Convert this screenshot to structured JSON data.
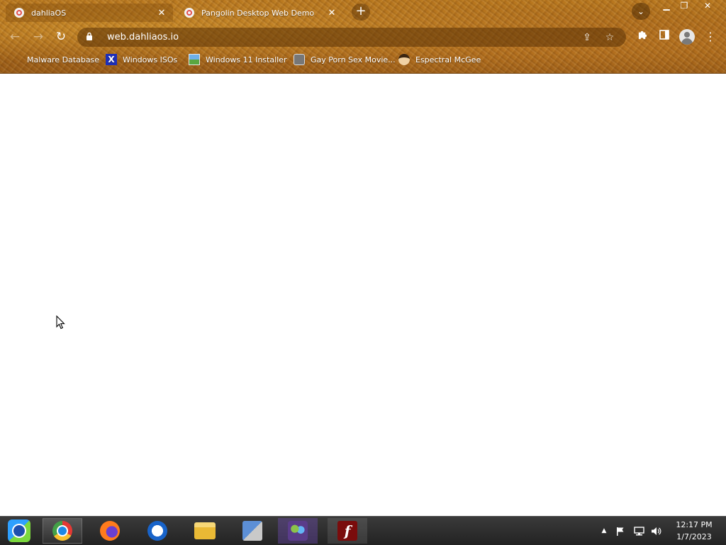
{
  "tabs": [
    {
      "title": "dahliaOS",
      "active": true
    },
    {
      "title": "Pangolin Desktop Web Demo",
      "active": false
    }
  ],
  "toolbar": {
    "url": "web.dahliaos.io"
  },
  "bookmarks": [
    {
      "label": "Malware Database",
      "icon": "folder-icon"
    },
    {
      "label": "Windows ISOs",
      "icon": "x-icon"
    },
    {
      "label": "Windows 11 Installer",
      "icon": "image-icon"
    },
    {
      "label": "Gay Porn Sex Movie...",
      "icon": "film-icon"
    },
    {
      "label": "Espectral McGee",
      "icon": "face-icon"
    }
  ],
  "taskbar": {
    "apps": [
      "start-orb",
      "chrome",
      "firefox",
      "opera",
      "file-explorer",
      "setup",
      "users-app",
      "flash-player"
    ],
    "clock_time": "12:17 PM",
    "clock_date": "1/7/2023"
  },
  "theme": {
    "chrome_color": "#a8671a",
    "taskbar_color": "#2a2a2a"
  }
}
